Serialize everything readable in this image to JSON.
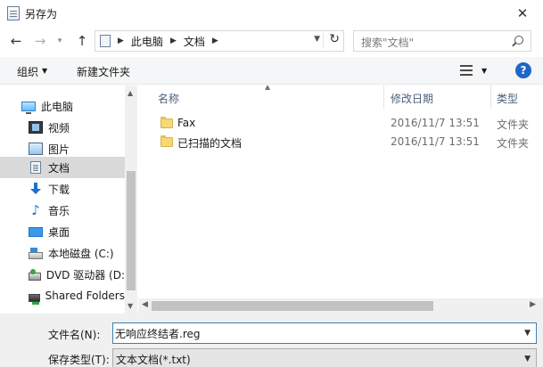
{
  "window": {
    "title": "另存为",
    "close_glyph": "✕"
  },
  "address": {
    "crumbs": [
      "此电脑",
      "文档"
    ]
  },
  "search": {
    "placeholder": "搜索\"文档\""
  },
  "toolbar": {
    "organize": "组织",
    "new_folder": "新建文件夹"
  },
  "nav": {
    "items": [
      {
        "label": "此电脑",
        "icon": "pc-icon"
      },
      {
        "label": "视频",
        "icon": "video-icon"
      },
      {
        "label": "图片",
        "icon": "pictures-icon"
      },
      {
        "label": "文档",
        "icon": "documents-icon",
        "selected": true
      },
      {
        "label": "下载",
        "icon": "download-icon"
      },
      {
        "label": "音乐",
        "icon": "music-icon"
      },
      {
        "label": "桌面",
        "icon": "desktop-icon"
      },
      {
        "label": "本地磁盘 (C:)",
        "icon": "local-disk-icon"
      },
      {
        "label": "DVD 驱动器 (D:",
        "icon": "dvd-drive-icon"
      },
      {
        "label": "Shared Folders",
        "icon": "network-share-icon"
      }
    ]
  },
  "columns": {
    "name": "名称",
    "date": "修改日期",
    "type": "类型"
  },
  "files": [
    {
      "name": "Fax",
      "date": "2016/11/7 13:51",
      "type": "文件夹"
    },
    {
      "name": "已扫描的文档",
      "date": "2016/11/7 13:51",
      "type": "文件夹"
    }
  ],
  "form": {
    "filename_label": "文件名(N):",
    "filename_value": "无响应终结者.reg",
    "filetype_label": "保存类型(T):",
    "filetype_value": "文本文档(*.txt)"
  },
  "help_glyph": "?"
}
